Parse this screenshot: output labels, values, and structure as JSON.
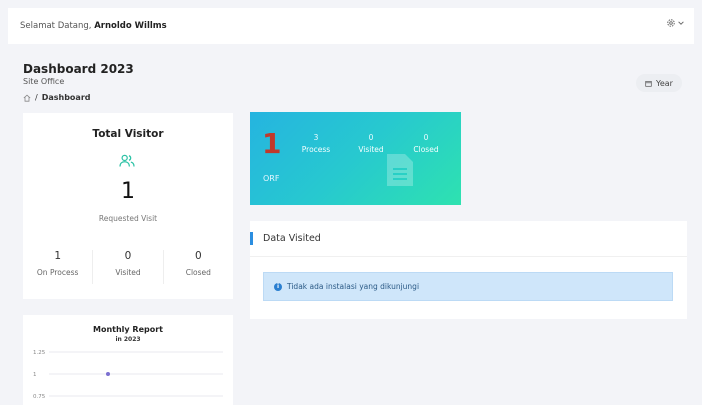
{
  "header": {
    "welcome_prefix": "Selamat Datang,",
    "user_name": "Arnoldo Willms",
    "settings_icon": "gear-icon"
  },
  "page": {
    "title": "Dashboard 2023",
    "subtitle": "Site Office",
    "breadcrumb_sep": "/",
    "breadcrumb_current": "Dashboard",
    "year_button": "Year"
  },
  "visitor": {
    "title": "Total Visitor",
    "count": "1",
    "label": "Requested Visit",
    "stats": [
      {
        "value": "1",
        "label": "On Process"
      },
      {
        "value": "0",
        "label": "Visited"
      },
      {
        "value": "0",
        "label": "Closed"
      }
    ]
  },
  "orf": {
    "count": "1",
    "label": "ORF",
    "cols": [
      {
        "value": "3",
        "label": "Process"
      },
      {
        "value": "0",
        "label": "Visited"
      },
      {
        "value": "0",
        "label": "Closed"
      }
    ]
  },
  "visited": {
    "title": "Data Visited",
    "alert": "Tidak ada instalasi yang dikunjungi"
  },
  "report": {
    "title": "Monthly Report",
    "subtitle": "in 2023"
  },
  "chart_data": {
    "type": "line",
    "title": "Monthly Report",
    "subtitle": "in 2023",
    "y_ticks": [
      "1.25",
      "1",
      "0.75"
    ],
    "ylim": [
      0.75,
      1.25
    ],
    "points": [
      {
        "x_frac": 0.5,
        "y": 1
      }
    ],
    "colors": {
      "point": "#7b6fd0",
      "grid": "#e9e9ef"
    }
  },
  "colors": {
    "accent": "#2b8ee0",
    "icon_teal": "#2ec3a6",
    "orf_number": "#c0392b"
  }
}
